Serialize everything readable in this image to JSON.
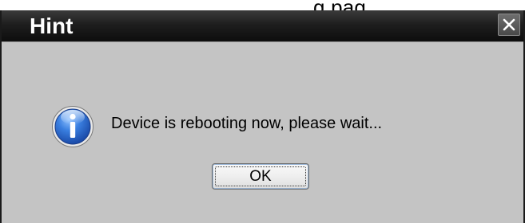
{
  "background": {
    "partial_text": "g pag"
  },
  "dialog": {
    "title": "Hint",
    "close_icon": "close-icon",
    "message_icon": "info-icon",
    "message": "Device is rebooting now, please wait...",
    "ok_label": "OK"
  },
  "colors": {
    "titlebar": "#141414",
    "title_text": "#ffffff",
    "dialog_body": "#c4c4c4",
    "info_icon_blue": "#2f6fd1"
  }
}
